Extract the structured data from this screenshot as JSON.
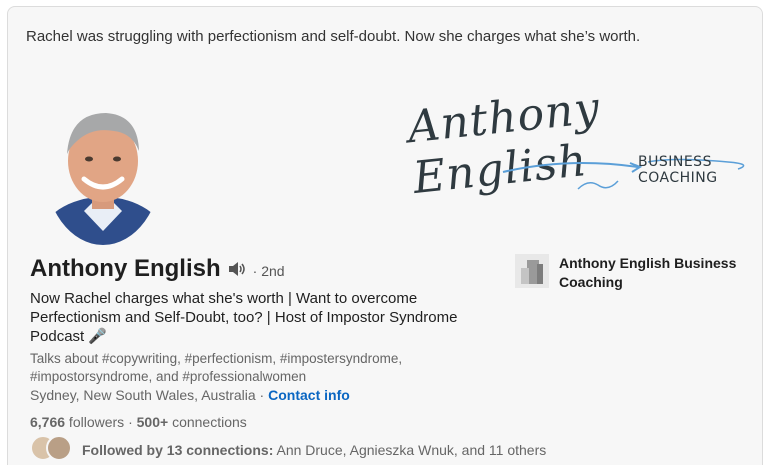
{
  "post": {
    "tagline": "Rachel was struggling with perfectionism and self-doubt. Now she charges what she’s worth."
  },
  "cover": {
    "logo_text": "Anthony English",
    "logo_subtext": "BUSINESS COACHING"
  },
  "profile": {
    "name": "Anthony English",
    "pronounce_icon": "speaker-icon",
    "degree": "· 2nd",
    "headline": "Now Rachel charges what she's worth | Want to overcome Perfectionism and Self-Doubt, too? | Host of Impostor Syndrome Podcast 🎤",
    "talks_about": "Talks about #copywriting, #perfectionism, #impostersyndrome, #impostorsyndrome, and #professionalwomen",
    "location": "Sydney, New South Wales, Australia",
    "location_sep": " · ",
    "contact_label": "Contact info",
    "followers_count": "6,766",
    "followers_label": " followers",
    "connections_sep": " · ",
    "connections_count": "500+",
    "connections_label": " connections",
    "followed_by_label": "Followed by 13 connections:",
    "followed_by_names": " Ann Druce, Agnieszka Wnuk, and 11 others"
  },
  "company": {
    "name": "Anthony English Business Coaching"
  },
  "colors": {
    "link": "#0a66c2",
    "card_bg": "#f7f7f7",
    "logo_arrow": "#5b9fd8"
  }
}
